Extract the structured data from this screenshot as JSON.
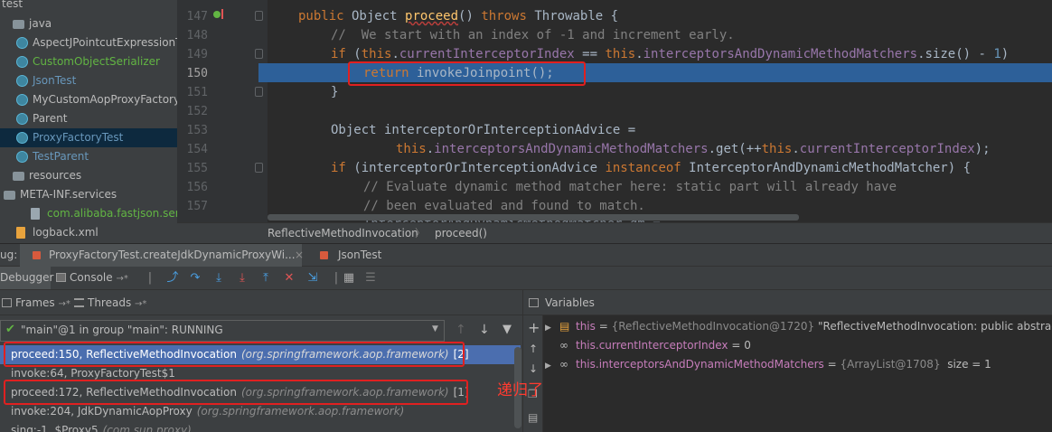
{
  "project_tree": {
    "root_label": "test",
    "items": [
      {
        "label": "java",
        "icon": "folder-icon",
        "style": "folder"
      },
      {
        "label": "AspectJPointcutExpressionTe",
        "icon": "class-icon",
        "style": "normal"
      },
      {
        "label": "CustomObjectSerializer",
        "icon": "class-icon",
        "style": "green"
      },
      {
        "label": "JsonTest",
        "icon": "class-icon",
        "style": "teal"
      },
      {
        "label": "MyCustomAopProxyFactory",
        "icon": "class-icon",
        "style": "normal"
      },
      {
        "label": "Parent",
        "icon": "class-icon",
        "style": "normal"
      },
      {
        "label": "ProxyFactoryTest",
        "icon": "class-icon",
        "style": "teal",
        "selected": true
      },
      {
        "label": "TestParent",
        "icon": "class-icon",
        "style": "teal"
      },
      {
        "label": "resources",
        "icon": "folder-icon",
        "style": "folder"
      },
      {
        "label": "META-INF.services",
        "icon": "folder-icon",
        "style": "folder"
      },
      {
        "label": "com.alibaba.fastjson.seria",
        "icon": "file-icon",
        "style": "green"
      },
      {
        "label": "logback.xml",
        "icon": "xml-icon",
        "style": "normal"
      }
    ]
  },
  "editor": {
    "line_numbers": [
      "147",
      "148",
      "149",
      "150",
      "151",
      "152",
      "153",
      "154",
      "155",
      "156",
      "157"
    ],
    "current_line": "150"
  },
  "breadcrumb": {
    "class_name": "ReflectiveMethodInvocation",
    "separator": "〉",
    "method_name": "proceed()"
  },
  "debug": {
    "label": "ug:",
    "session_tab": "ProxyFactoryTest.createJdkDynamicProxyWi...",
    "close_glyph": "×",
    "other_tab": "JsonTest",
    "debugger_tab": "Debugger",
    "console_tab": "Console",
    "tab_arrow": "→*"
  },
  "frames_panel": {
    "frames_tab": "Frames",
    "threads_tab": "Threads",
    "arrow": "→*",
    "thread_selector": "\"main\"@1 in group \"main\": RUNNING",
    "rows": [
      {
        "method": "proceed:150, ReflectiveMethodInvocation",
        "pkg": "(org.springframework.aop.framework)",
        "depth": "[2]",
        "selected": true
      },
      {
        "method": "invoke:64, ProxyFactoryTest$1",
        "pkg": "",
        "depth": ""
      },
      {
        "method": "proceed:172, ReflectiveMethodInvocation",
        "pkg": "(org.springframework.aop.framework)",
        "depth": "[1]"
      },
      {
        "method": "invoke:204, JdkDynamicAopProxy",
        "pkg": "(org.springframework.aop.framework)",
        "depth": ""
      },
      {
        "method": "sing:-1, $Proxy5",
        "pkg": "(com.sun.proxy)",
        "depth": ""
      }
    ]
  },
  "variables_panel": {
    "title": "Variables",
    "rows": [
      {
        "expander": "▶",
        "name": "this",
        "eq": " = ",
        "type": "{ReflectiveMethodInvocation@1720}",
        "value": " \"ReflectiveMethodInvocation: public abstract vo"
      },
      {
        "expander": "",
        "name": "this.currentInterceptorIndex",
        "eq": " = ",
        "type": "",
        "value": "0"
      },
      {
        "expander": "▶",
        "name": "this.interceptorsAndDynamicMethodMatchers",
        "eq": " = ",
        "type": "{ArrayList@1708}",
        "value": "  size = 1"
      }
    ]
  },
  "annotation": "递归了",
  "colors": {
    "keyword": "#cc7832",
    "method": "#ffc66d",
    "field": "#9876aa",
    "comment": "#808080",
    "execution_line": "#2d6099",
    "highlight_box": "#e02020",
    "selected_frame": "#4b6eaf"
  }
}
